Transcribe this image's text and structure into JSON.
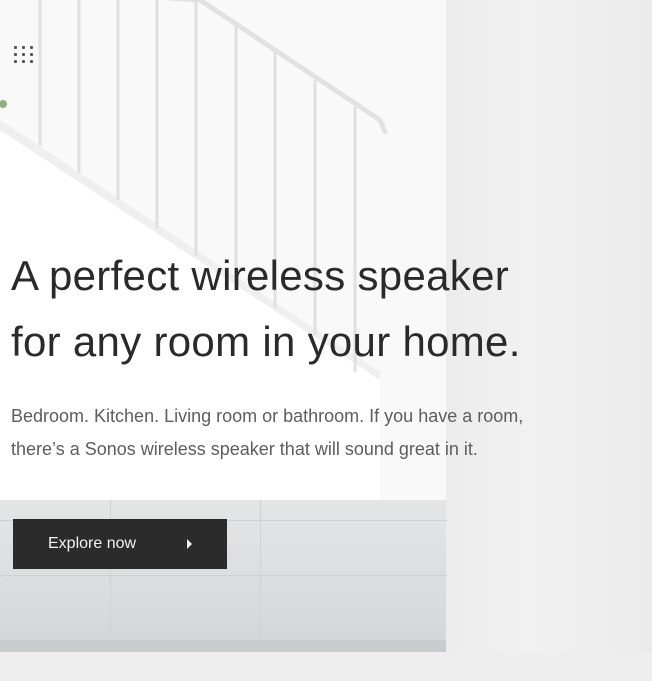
{
  "hero": {
    "headline_line1": "A perfect wireless speaker",
    "headline_line2": "for any room in your home.",
    "subtext_line1": "Bedroom. Kitchen. Living room or bathroom. If you have a room,",
    "subtext_line2": "there’s a Sonos wireless speaker that will sound great in it.",
    "cta_label": "Explore now"
  },
  "icons": {
    "menu": "grid-menu-icon",
    "cta": "caret-right-icon"
  },
  "colors": {
    "text": "#2a2a2a",
    "subtext": "#5d5d5d",
    "button": "#2b2b2b",
    "button_text": "#f2f2f2"
  }
}
